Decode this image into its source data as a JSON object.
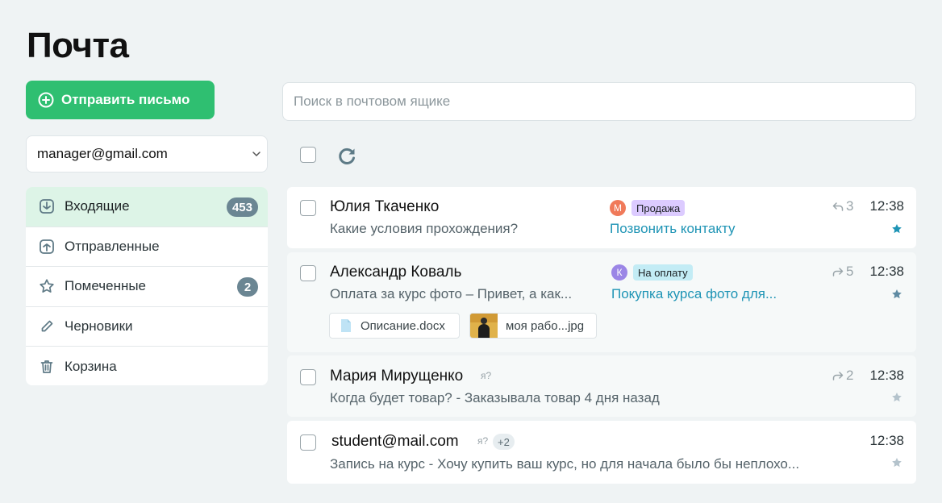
{
  "page_title": "Почта",
  "compose_label": "Отправить письмо",
  "account": "manager@gmail.com",
  "search_placeholder": "Поиск в почтовом ящике",
  "folders": [
    {
      "label": "Входящие",
      "badge": "453",
      "icon": "inbox-icon"
    },
    {
      "label": "Отправленные",
      "badge": "",
      "icon": "sent-icon"
    },
    {
      "label": "Помеченные",
      "badge": "2",
      "icon": "star-outline-icon"
    },
    {
      "label": "Черновики",
      "badge": "",
      "icon": "pencil-icon"
    },
    {
      "label": "Корзина",
      "badge": "",
      "icon": "trash-icon"
    }
  ],
  "messages": [
    {
      "sender": "Юлия Ткаченко",
      "preview": "Какие условия прохождения?",
      "time": "12:38",
      "counter": "3",
      "counter_icon": "reply-icon",
      "avatar": "М",
      "tag": "Продажа",
      "deal": "Позвонить контакту",
      "starred": true
    },
    {
      "sender": "Александр Коваль",
      "preview": "Оплата за курс фото – Привет, а как...",
      "time": "12:38",
      "counter": "5",
      "counter_icon": "forward-icon",
      "avatar": "К",
      "tag": "На оплату",
      "deal": "Покупка курса фото для...",
      "starred": true,
      "attachments": [
        {
          "name": "Описание.docx",
          "icon": "file-icon"
        },
        {
          "name": "моя рабо...jpg",
          "icon": "image-thumbnail"
        }
      ]
    },
    {
      "sender": "Мария Мирущенко",
      "preview": "Когда будет товар? - Заказывала товар 4 дня назад",
      "time": "12:38",
      "counter": "2",
      "counter_icon": "forward-icon",
      "unknown_mark": "я?",
      "starred": false
    },
    {
      "sender": "student@mail.com",
      "preview": "Запись на курс - Хочу купить ваш курс, но для начала было бы неплохо...",
      "time": "12:38",
      "unknown_mark": "я?",
      "extra_recipients": "+2",
      "starred": false
    }
  ],
  "colors": {
    "accent_green": "#2fbf71",
    "active_folder_bg": "#ddf4e7",
    "badge_bg": "#6b8693",
    "link_blue": "#1e94b5",
    "avatar_orange": "#f07a5a",
    "avatar_purple": "#9b86e6",
    "tag_purple": "#dccbff",
    "tag_cyan": "#c3ecf5",
    "star_active": "#1e94b5",
    "star_inactive": "#b4c3cc"
  }
}
